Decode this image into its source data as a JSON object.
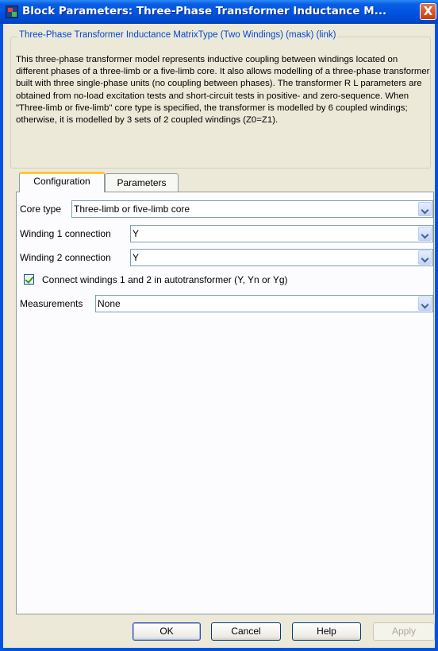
{
  "window": {
    "title": "Block Parameters: Three-Phase Transformer Inductance M...",
    "close_glyph": "X"
  },
  "group": {
    "title": "Three-Phase Transformer Inductance MatrixType (Two Windings) (mask) (link)",
    "description": "This three-phase transformer model represents inductive coupling between windings located on different phases of a three-limb or a five-limb core.  It also allows modelling of a three-phase transformer built with three single-phase units (no coupling between phases). The transformer R L parameters are obtained from no-load excitation tests and short-circuit tests in positive- and zero-sequence. When \"Three-limb or five-limb\" core type is specified, the transformer is modelled by 6 coupled windings; otherwise, it is modelled by 3 sets of 2 coupled windings (Z0=Z1)."
  },
  "tabs": [
    {
      "label": "Configuration",
      "active": true
    },
    {
      "label": "Parameters",
      "active": false
    }
  ],
  "fields": {
    "core_type": {
      "label": "Core type",
      "value": "Three-limb or five-limb core"
    },
    "winding1": {
      "label": "Winding 1 connection",
      "value": "Y"
    },
    "winding2": {
      "label": "Winding 2 connection",
      "value": "Y"
    },
    "autotransformer": {
      "label": "Connect windings 1 and 2  in autotransformer  (Y, Yn or Yg)",
      "checked": true
    },
    "measurements": {
      "label": "Measurements",
      "value": "None"
    }
  },
  "buttons": {
    "ok": "OK",
    "cancel": "Cancel",
    "help": "Help",
    "apply": "Apply"
  },
  "colors": {
    "titlebar": "#0054E3",
    "group_title": "#0046D5",
    "active_tab_accent": "#FFC83C",
    "checkmark": "#21A121"
  },
  "icons": {
    "title_icon": "simulink-block-icon",
    "close": "close-icon",
    "dropdown": "chevron-down-icon"
  }
}
